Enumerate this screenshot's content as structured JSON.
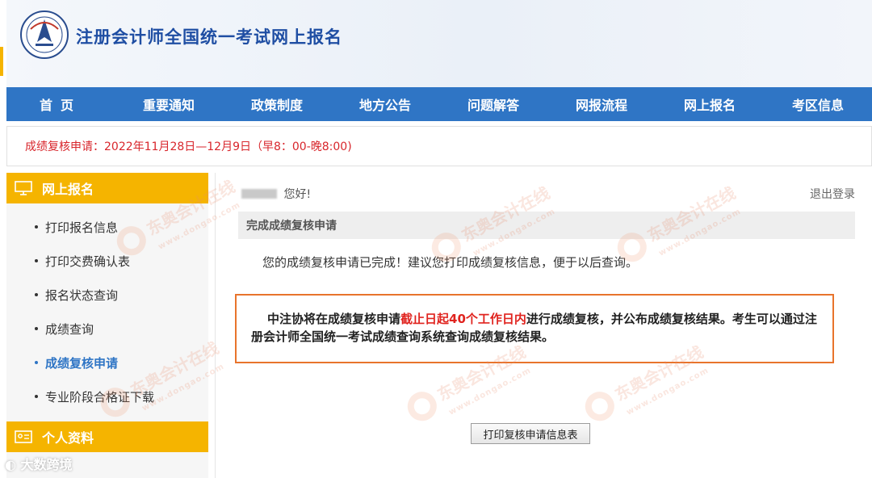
{
  "header": {
    "title": "注册会计师全国统一考试网上报名"
  },
  "nav": [
    {
      "label": "首页"
    },
    {
      "label": "重要通知"
    },
    {
      "label": "政策制度"
    },
    {
      "label": "地方公告"
    },
    {
      "label": "问题解答"
    },
    {
      "label": "网报流程"
    },
    {
      "label": "网上报名"
    },
    {
      "label": "考区信息"
    }
  ],
  "notice": {
    "text": "成绩复核申请：2022年11月28日—12月9日（早8：00-晚8:00)"
  },
  "sidebar": {
    "section1": "网上报名",
    "items": [
      {
        "label": "打印报名信息"
      },
      {
        "label": "打印交费确认表"
      },
      {
        "label": "报名状态查询"
      },
      {
        "label": "成绩查询"
      },
      {
        "label": "成绩复核申请"
      },
      {
        "label": "专业阶段合格证下载"
      }
    ],
    "active_index": 4,
    "section2": "个人资料"
  },
  "main": {
    "greeting": "您好!",
    "logout": "退出登录",
    "section_title": "完成成绩复核申请",
    "done_message": "您的成绩复核申请已完成！建议您打印成绩复核信息，便于以后查询。",
    "info_part1": "中注协将在成绩复核申请",
    "info_highlight": "截止日起40个工作日内",
    "info_part2": "进行成绩复核，并公布成绩复核结果。考生可以通过注册会计师全国统一考试成绩查询系统查询成绩复核结果。",
    "print_button": "打印复核申请信息表"
  },
  "watermark": {
    "text": "东奥会计在线",
    "sub": "www.dongao.com"
  },
  "credit": "大数跨境",
  "colors": {
    "nav_bg": "#2f75c5",
    "sidebar_header": "#f5b400",
    "notice_text": "#d8262c",
    "highlight": "#e0241f",
    "box_border": "#e8742c",
    "title": "#1f4ea3"
  }
}
